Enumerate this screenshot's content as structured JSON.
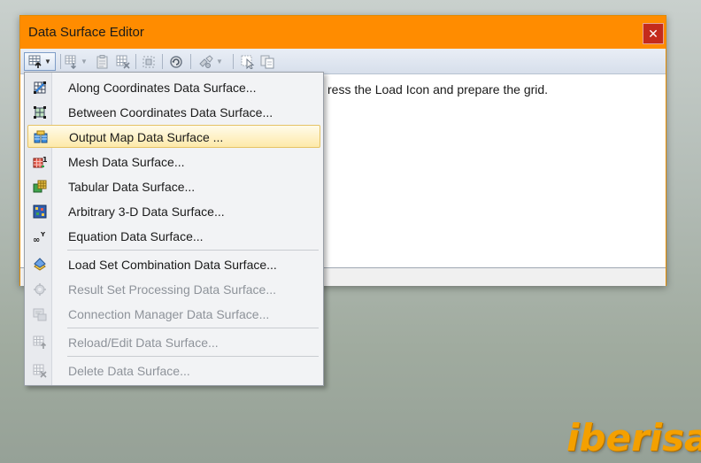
{
  "window": {
    "title": "Data Surface Editor",
    "close_label": "✕",
    "hint_text": "ress the Load Icon and prepare the grid."
  },
  "toolbar": {
    "buttons": [
      {
        "name": "new-data-surface-icon",
        "has_caret": true,
        "active": true
      },
      {
        "name": "import-icon",
        "has_caret": true
      },
      {
        "name": "clipboard-paste-icon"
      },
      {
        "name": "delete-grid-icon"
      },
      {
        "name": "select-icon"
      },
      {
        "name": "refresh-icon"
      },
      {
        "name": "tools-icon",
        "has_caret": true
      },
      {
        "name": "cursor-select-icon"
      },
      {
        "name": "copy-icon"
      }
    ]
  },
  "menu": {
    "items": [
      {
        "label": "Along Coordinates Data Surface...",
        "icon": "along-coordinates-icon",
        "enabled": true
      },
      {
        "label": "Between Coordinates Data Surface...",
        "icon": "between-coordinates-icon",
        "enabled": true
      },
      {
        "label": "Output Map Data Surface ...",
        "icon": "output-map-icon",
        "enabled": true,
        "highlighted": true
      },
      {
        "label": "Mesh Data Surface...",
        "icon": "mesh-icon",
        "enabled": true
      },
      {
        "label": "Tabular Data Surface...",
        "icon": "tabular-icon",
        "enabled": true
      },
      {
        "label": "Arbitrary 3-D Data Surface...",
        "icon": "arbitrary-3d-icon",
        "enabled": true
      },
      {
        "label": "Equation Data Surface...",
        "icon": "equation-icon",
        "enabled": true
      },
      {
        "label": "Load Set Combination Data Surface...",
        "icon": "load-set-combination-icon",
        "enabled": true
      },
      {
        "label": "Result Set Processing Data Surface...",
        "icon": "result-set-processing-icon",
        "enabled": false
      },
      {
        "label": "Connection Manager Data Surface...",
        "icon": "connection-manager-icon",
        "enabled": false
      },
      {
        "label": "Reload/Edit Data Surface...",
        "icon": "reload-edit-icon",
        "enabled": false
      },
      {
        "label": "Delete Data Surface...",
        "icon": "delete-icon",
        "enabled": false
      }
    ]
  },
  "watermark": {
    "text": "iberisa"
  },
  "colors": {
    "titlebar": "#ff8c00",
    "close_button": "#c42b1c",
    "highlight": "#fde9a9",
    "logo": "#f4a000"
  }
}
